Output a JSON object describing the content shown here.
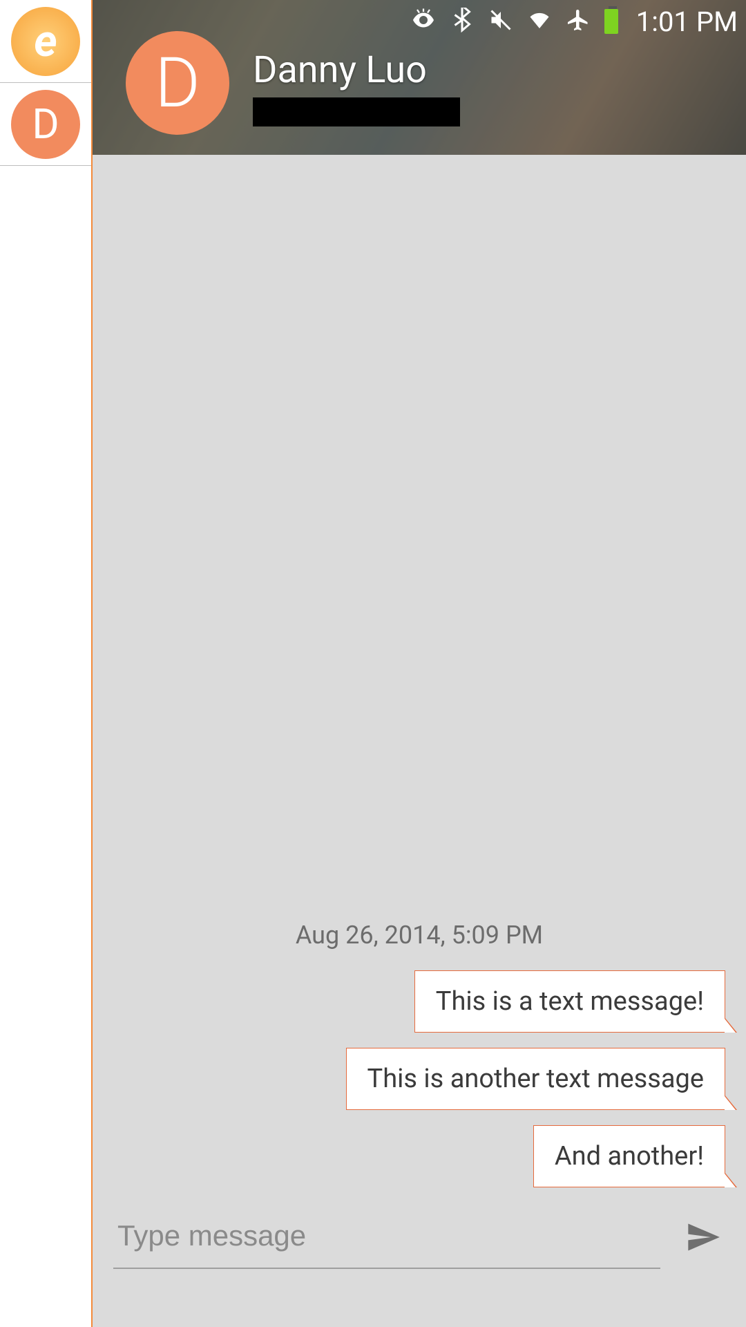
{
  "statusbar": {
    "time": "1:01 PM",
    "icons": [
      "eye-icon",
      "bluetooth-icon",
      "mute-icon",
      "wifi-icon",
      "airplane-icon",
      "battery-icon"
    ]
  },
  "rail": {
    "app_logo_glyph": "e",
    "contact_initial": "D"
  },
  "header": {
    "avatar_initial": "D",
    "contact_name": "Danny Luo"
  },
  "conversation": {
    "date_separator": "Aug 26, 2014, 5:09 PM",
    "messages": [
      {
        "text": "This is a text message!",
        "direction": "out"
      },
      {
        "text": "This is another text message",
        "direction": "out"
      },
      {
        "text": "And another!",
        "direction": "out"
      }
    ]
  },
  "composer": {
    "placeholder": "Type message"
  }
}
